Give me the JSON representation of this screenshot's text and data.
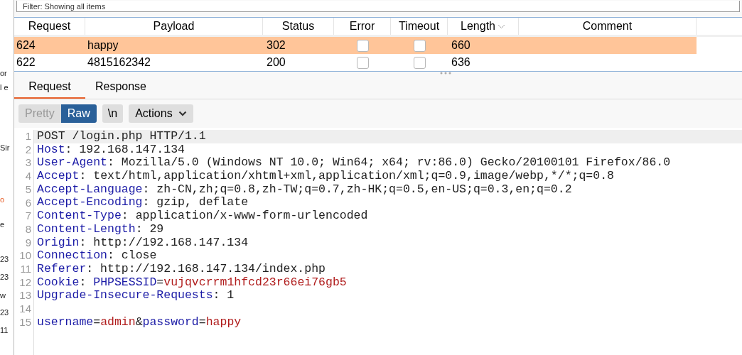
{
  "filter": {
    "value": "Filter: Showing all items"
  },
  "side_fragments": [
    "or",
    "l e",
    "Sir",
    "o",
    "e",
    "23",
    "23",
    "w",
    "23",
    "11"
  ],
  "table": {
    "columns": [
      {
        "label": "Request",
        "sorted": false
      },
      {
        "label": "Payload",
        "sorted": false
      },
      {
        "label": "Status",
        "sorted": false
      },
      {
        "label": "Error",
        "sorted": false
      },
      {
        "label": "Timeout",
        "sorted": false
      },
      {
        "label": "Length",
        "sorted": true
      },
      {
        "label": "Comment",
        "sorted": false
      }
    ],
    "rows": [
      {
        "request": "624",
        "payload": "happy",
        "status": "302",
        "error": false,
        "timeout": false,
        "length": "660",
        "selected": true
      },
      {
        "request": "622",
        "payload": "4815162342",
        "status": "200",
        "error": false,
        "timeout": false,
        "length": "636",
        "selected": false
      }
    ]
  },
  "tabs": [
    {
      "label": "Request",
      "selected": true
    },
    {
      "label": "Response",
      "selected": false
    }
  ],
  "toolbar": {
    "view_modes": [
      {
        "label": "Pretty",
        "selected": false
      },
      {
        "label": "Raw",
        "selected": true
      }
    ],
    "newline_button": "\\n",
    "actions_button": "Actions"
  },
  "editor": {
    "lines": [
      {
        "number": "1",
        "highlighted": true,
        "segments": [
          {
            "text": "POST /login.php HTTP/1.1",
            "kind": "plain"
          }
        ]
      },
      {
        "number": "2",
        "highlighted": false,
        "segments": [
          {
            "text": "Host",
            "kind": "key"
          },
          {
            "text": ": 192.168.147.134",
            "kind": "plain"
          }
        ]
      },
      {
        "number": "3",
        "highlighted": false,
        "segments": [
          {
            "text": "User-Agent",
            "kind": "key"
          },
          {
            "text": ": Mozilla/5.0 (Windows NT 10.0; Win64; x64; rv:86.0) Gecko/20100101 Firefox/86.0",
            "kind": "plain"
          }
        ]
      },
      {
        "number": "4",
        "highlighted": false,
        "segments": [
          {
            "text": "Accept",
            "kind": "key"
          },
          {
            "text": ": text/html,application/xhtml+xml,application/xml;q=0.9,image/webp,*/*;q=0.8",
            "kind": "plain"
          }
        ]
      },
      {
        "number": "5",
        "highlighted": false,
        "segments": [
          {
            "text": "Accept-Language",
            "kind": "key"
          },
          {
            "text": ": zh-CN,zh;q=0.8,zh-TW;q=0.7,zh-HK;q=0.5,en-US;q=0.3,en;q=0.2",
            "kind": "plain"
          }
        ]
      },
      {
        "number": "6",
        "highlighted": false,
        "segments": [
          {
            "text": "Accept-Encoding",
            "kind": "key"
          },
          {
            "text": ": gzip, deflate",
            "kind": "plain"
          }
        ]
      },
      {
        "number": "7",
        "highlighted": false,
        "segments": [
          {
            "text": "Content-Type",
            "kind": "key"
          },
          {
            "text": ": application/x-www-form-urlencoded",
            "kind": "plain"
          }
        ]
      },
      {
        "number": "8",
        "highlighted": false,
        "segments": [
          {
            "text": "Content-Length",
            "kind": "key"
          },
          {
            "text": ": 29",
            "kind": "plain"
          }
        ]
      },
      {
        "number": "9",
        "highlighted": false,
        "segments": [
          {
            "text": "Origin",
            "kind": "key"
          },
          {
            "text": ": http://192.168.147.134",
            "kind": "plain"
          }
        ]
      },
      {
        "number": "10",
        "highlighted": false,
        "segments": [
          {
            "text": "Connection",
            "kind": "key"
          },
          {
            "text": ": close",
            "kind": "plain"
          }
        ]
      },
      {
        "number": "11",
        "highlighted": false,
        "segments": [
          {
            "text": "Referer",
            "kind": "key"
          },
          {
            "text": ": http://192.168.147.134/index.php",
            "kind": "plain"
          }
        ]
      },
      {
        "number": "12",
        "highlighted": false,
        "segments": [
          {
            "text": "Cookie",
            "kind": "key"
          },
          {
            "text": ": ",
            "kind": "plain"
          },
          {
            "text": "PHPSESSID",
            "kind": "key"
          },
          {
            "text": "=",
            "kind": "plain"
          },
          {
            "text": "vujqvcrrm1hfcd23r66ei76gb5",
            "kind": "value"
          }
        ]
      },
      {
        "number": "13",
        "highlighted": false,
        "segments": [
          {
            "text": "Upgrade-Insecure-Requests",
            "kind": "key"
          },
          {
            "text": ": 1",
            "kind": "plain"
          }
        ]
      },
      {
        "number": "14",
        "highlighted": false
      },
      {
        "number": "15",
        "highlighted": false,
        "segments": [
          {
            "text": "username",
            "kind": "key"
          },
          {
            "text": "=",
            "kind": "plain"
          },
          {
            "text": "admin",
            "kind": "value"
          },
          {
            "text": "&",
            "kind": "plain"
          },
          {
            "text": "password",
            "kind": "key"
          },
          {
            "text": "=",
            "kind": "plain"
          },
          {
            "text": "happy",
            "kind": "value"
          }
        ]
      }
    ]
  }
}
